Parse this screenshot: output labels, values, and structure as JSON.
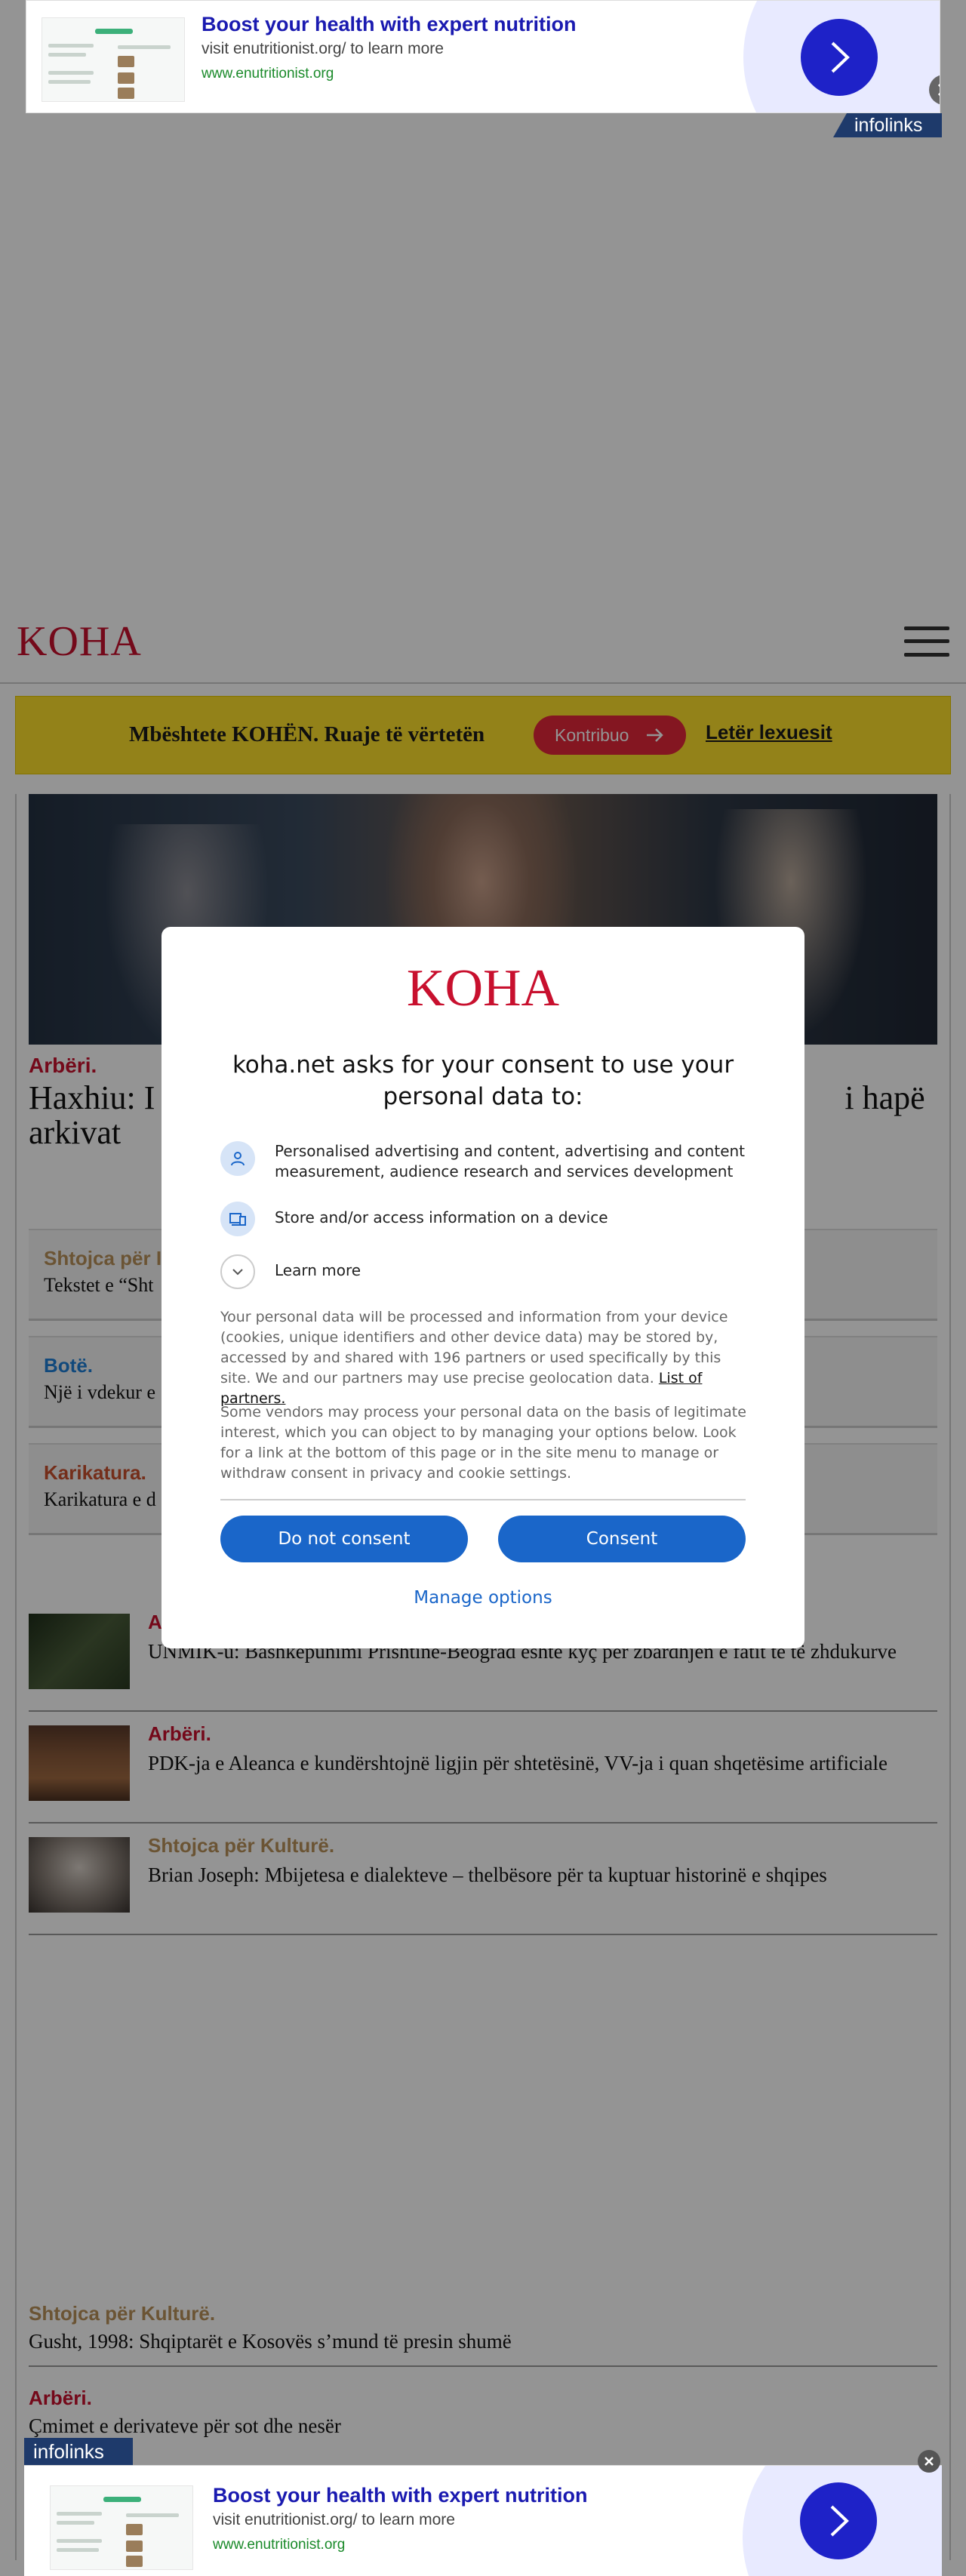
{
  "ad": {
    "title": "Boost your health with expert nutrition",
    "subtitle": "visit enutritionist.org/ to learn more",
    "url": "www.enutritionist.org",
    "network": "infolinks"
  },
  "header": {
    "logo": "KOHA"
  },
  "support": {
    "text": "Mbështete KOHËN. Ruaje të vërtetën",
    "contribute": "Kontribuo",
    "reader_letter": "Letër lexuesit"
  },
  "hero": {
    "category": "Arbëri.",
    "title_start": "Haxhiu: I",
    "title_end": "i hapë",
    "title_line2": "arkivat"
  },
  "cards": [
    {
      "category": "Shtojca për I",
      "text": "Tekstet e “Sht",
      "color": "#b8925a"
    },
    {
      "category": "Botë.",
      "text": "Një i vdekur e",
      "color": "#1e7fd6"
    },
    {
      "category": "Karikatura.",
      "text": "Karikatura e d",
      "color": "#c8502e"
    }
  ],
  "articles": [
    {
      "category": "A",
      "title": "UNMIK-u: Bashkëpunimi Prishtinë-Beograd është kyç për zbardhjen e fatit të të zhdukurve",
      "color": "#c8102e"
    },
    {
      "category": "Arbëri.",
      "title": "PDK-ja e Aleanca e kundërshtojnë ligjin për shtetësinë, VV-ja i quan shqetësime artificiale",
      "color": "#c8102e"
    },
    {
      "category": "Shtojca për Kulturë.",
      "title": "Brian Joseph:  Mbijetesa e dialekteve – thelbësore për ta kuptuar historinë e shqipes",
      "color": "#b8925a"
    }
  ],
  "lower_articles": [
    {
      "category": "Shtojca për Kulturë.",
      "title": "Gusht, 1998:  Shqiptarët e Kosovës s’mund të presin shumë",
      "color": "#b8925a"
    },
    {
      "category": "Arbëri.",
      "title": "Çmimet e derivateve për sot dhe nesër",
      "color": "#c8102e"
    }
  ],
  "consent": {
    "logo": "KOHA",
    "heading": "koha.net asks for your consent to use your personal data to:",
    "purposes": [
      "Personalised advertising and content, advertising and content measurement, audience research and services development",
      "Store and/or access information on a device"
    ],
    "learn_more": "Learn more",
    "paragraph1": "Your personal data will be processed and information from your device (cookies, unique identifiers and other device data) may be stored by, accessed by and shared with 196 partners or used specifically by this site. We and our partners may use precise geolocation data.",
    "partners_link": "List of partners.",
    "paragraph2": "Some vendors may process your personal data on the basis of legitimate interest, which you can object to by managing your options below. Look for a link at the bottom of this page or in the site menu to manage or withdraw consent in privacy and cookie settings.",
    "do_not_consent": "Do not consent",
    "consent": "Consent",
    "manage_options": "Manage options"
  },
  "colors": {
    "brand_red": "#c8102e",
    "support_yellow": "#fde02b",
    "consent_blue": "#1a66c9",
    "ad_blue": "#1e22c8"
  }
}
